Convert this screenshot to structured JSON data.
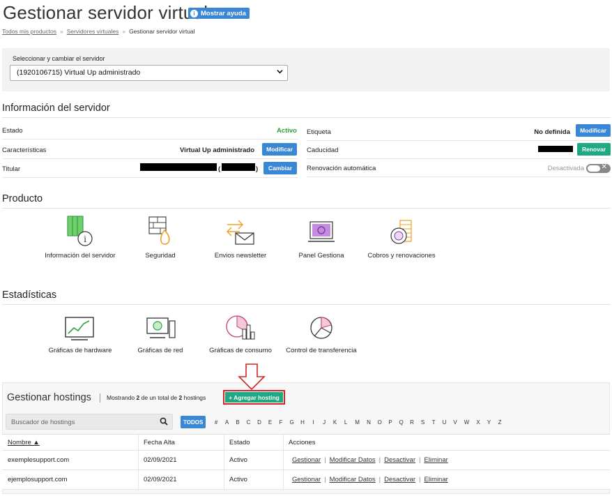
{
  "header": {
    "title": "Gestionar servidor virtual",
    "help_button": "Mostrar ayuda"
  },
  "breadcrumb": {
    "items": [
      "Todos mis productos",
      "Servidores virtuales",
      "Gestionar servidor virtual"
    ],
    "separator": "»"
  },
  "server_selector": {
    "label": "Seleccionar y cambiar el servidor",
    "selected": "(1920106715) Virtual Up administrado"
  },
  "server_info": {
    "title": "Información del servidor",
    "left": [
      {
        "key": "Estado",
        "value": "Activo"
      },
      {
        "key": "Características",
        "value": "Virtual Up administrado",
        "button": "Modificar"
      },
      {
        "key": "Titular",
        "value_suffix": "(",
        "value_end": ")",
        "button": "Cambiar"
      }
    ],
    "right": [
      {
        "key": "Etiqueta",
        "value": "No definida",
        "button": "Modificar"
      },
      {
        "key": "Caducidad",
        "button": "Renovar"
      },
      {
        "key": "Renovación automática",
        "value": "Desactivada",
        "toggle_state": "off",
        "toggle_mark": "✕"
      }
    ]
  },
  "product": {
    "title": "Producto",
    "tiles": [
      {
        "label": "Información del servidor",
        "icon": "server-info-icon"
      },
      {
        "label": "Seguridad",
        "icon": "firewall-icon"
      },
      {
        "label": "Envios newsletter",
        "icon": "newsletter-icon"
      },
      {
        "label": "Panel Gestiona",
        "icon": "panel-icon"
      },
      {
        "label": "Cobros y renovaciones",
        "icon": "billing-icon"
      }
    ]
  },
  "stats": {
    "title": "Estadísticas",
    "tiles": [
      {
        "label": "Gráficas de hardware",
        "icon": "hardware-chart-icon"
      },
      {
        "label": "Gráficas de red",
        "icon": "network-chart-icon"
      },
      {
        "label": "Gráficas de consumo",
        "icon": "consumption-chart-icon"
      },
      {
        "label": "Control de transferencia",
        "icon": "transfer-icon"
      }
    ]
  },
  "hostings": {
    "title": "Gestionar hostings",
    "count_prefix": "Mostrando ",
    "count_shown": "2",
    "count_middle": " de un total de ",
    "count_total": "2",
    "count_suffix": " hostings",
    "add_button": "+ Agregar hosting",
    "search_placeholder": "Buscador de hostings",
    "alpha_all": "TODOS",
    "alpha": [
      "#",
      "A",
      "B",
      "C",
      "D",
      "E",
      "F",
      "G",
      "H",
      "I",
      "J",
      "K",
      "L",
      "M",
      "N",
      "O",
      "P",
      "Q",
      "R",
      "S",
      "T",
      "U",
      "V",
      "W",
      "X",
      "Y",
      "Z"
    ],
    "columns": [
      "Nombre ▲",
      "Fecha Alta",
      "Estado",
      "Acciones"
    ],
    "rows": [
      {
        "name": "exemplesupport.com",
        "date": "02/09/2021",
        "status": "Activo"
      },
      {
        "name": "ejemplosupport.com",
        "date": "02/09/2021",
        "status": "Activo"
      }
    ],
    "actions": [
      "Gestionar",
      "Modificar Datos",
      "Desactivar",
      "Eliminar"
    ]
  },
  "colors": {
    "blue": "#3a87d6",
    "green": "#1fa882",
    "highlight_red": "#d42525"
  }
}
